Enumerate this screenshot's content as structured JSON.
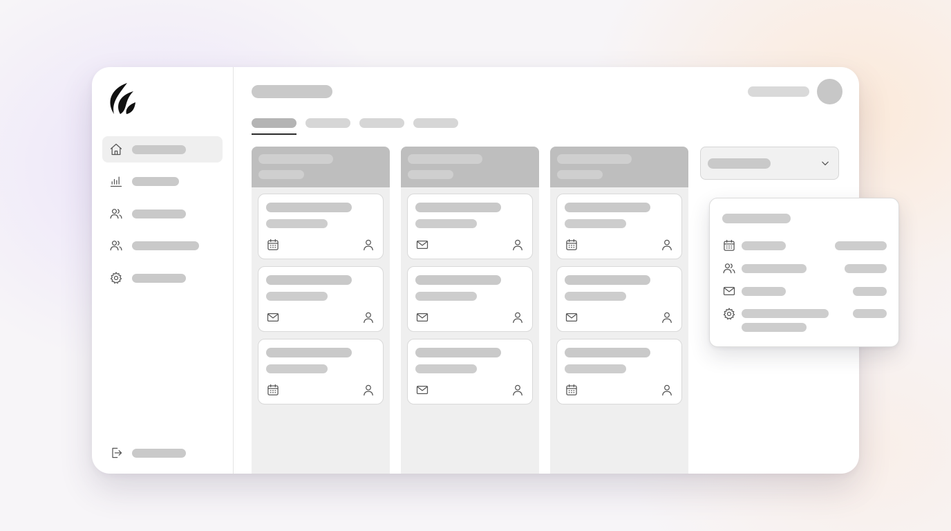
{
  "app": {
    "logo_icon": "flame-logo-icon",
    "theme": {
      "window_bg": "#ffffff",
      "skeleton": "#c9c9c9",
      "column_header": "#bebebe",
      "column_bg": "#efefef",
      "active_tab_underline": "#2b2b2b"
    }
  },
  "sidebar": {
    "items": [
      {
        "name": "home",
        "icon": "home-icon",
        "active": true
      },
      {
        "name": "analytics",
        "icon": "bar-chart-icon",
        "active": false
      },
      {
        "name": "team",
        "icon": "users-icon",
        "active": false
      },
      {
        "name": "contacts",
        "icon": "users-icon",
        "active": false
      },
      {
        "name": "settings",
        "icon": "gear-icon",
        "active": false
      }
    ],
    "footer": {
      "icon": "logout-icon"
    }
  },
  "header": {
    "avatar_icon": "avatar"
  },
  "tabs": {
    "count": 4,
    "active_index": 0
  },
  "board": {
    "columns": [
      {
        "cards": [
          {
            "left_icon": "calendar-icon",
            "right_icon": "user-icon"
          },
          {
            "left_icon": "mail-icon",
            "right_icon": "user-icon"
          },
          {
            "left_icon": "calendar-icon",
            "right_icon": "user-icon"
          }
        ]
      },
      {
        "cards": [
          {
            "left_icon": "mail-icon",
            "right_icon": "user-icon"
          },
          {
            "left_icon": "mail-icon",
            "right_icon": "user-icon"
          },
          {
            "left_icon": "mail-icon",
            "right_icon": "user-icon"
          }
        ]
      },
      {
        "cards": [
          {
            "left_icon": "calendar-icon",
            "right_icon": "user-icon"
          },
          {
            "left_icon": "mail-icon",
            "right_icon": "user-icon"
          },
          {
            "left_icon": "calendar-icon",
            "right_icon": "user-icon"
          }
        ]
      }
    ]
  },
  "dropdown": {
    "icon": "chevron-down-icon"
  },
  "popover": {
    "rows": [
      {
        "icon": "calendar-icon"
      },
      {
        "icon": "users-icon"
      },
      {
        "icon": "mail-icon"
      },
      {
        "icon": "gear-icon"
      }
    ]
  }
}
